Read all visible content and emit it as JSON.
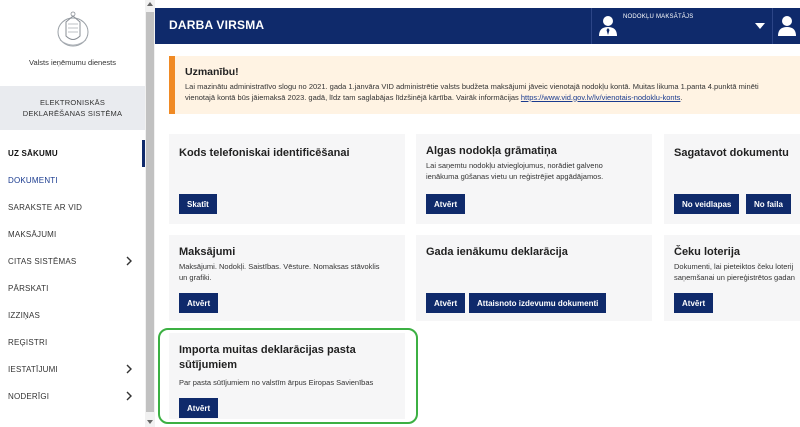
{
  "sidebar": {
    "org_name": "Valsts ieņēmumu dienests",
    "system_line1": "ELEKTRONISKĀS",
    "system_line2": "DEKLARĒŠANAS SISTĒMA",
    "items": [
      {
        "label": "UZ SĀKUMU",
        "active": true
      },
      {
        "label": "DOKUMENTI"
      },
      {
        "label": "SARAKSTE AR VID"
      },
      {
        "label": "MAKSĀJUMI"
      },
      {
        "label": "CITAS SISTĒMAS",
        "expandable": true
      },
      {
        "label": "PĀRSKATI"
      },
      {
        "label": "IZZIŅAS"
      },
      {
        "label": "REĢISTRI"
      },
      {
        "label": "IESTATĪJUMI",
        "expandable": true
      },
      {
        "label": "NODERĪGI",
        "expandable": true
      }
    ]
  },
  "header": {
    "title": "DARBA VIRSMA",
    "user_role": "NODOKĻU MAKSĀTĀJS"
  },
  "warning": {
    "title": "Uzmanību!",
    "line1": "Lai mazinātu administratīvo slogu no 2021. gada 1.janvāra VID administrētie valsts budžeta maksājumi jāveic vienotajā nodokļu kontā. Muitas likuma 1.panta 4.punktā minēti",
    "line2": "vienotajā kontā būs jāiemaksā 2023. gadā, līdz tam saglabājas līdzšinējā kārtība. Vairāk informācijas ",
    "link": "https://www.vid.gov.lv/lv/vienotais-nodoklu-konts",
    "line2_end": "."
  },
  "cards": {
    "kods": {
      "title": "Kods telefoniskai identificēšanai",
      "button": "Skatīt"
    },
    "algas": {
      "title": "Algas nodokļa grāmatiņa",
      "desc1": "Lai saņemtu nodokļu atvieglojumus, norādiet galveno",
      "desc2": "ienākuma gūšanas vietu un reģistrējiet apgādājamos.",
      "button": "Atvērt"
    },
    "sagatavot": {
      "title": "Sagatavot dokumentu",
      "button1": "No veidlapas",
      "button2": "No faila"
    },
    "maksajumi": {
      "title": "Maksājumi",
      "desc1": "Maksājumi. Nodokļi. Saistības. Vēsture. Nomaksas stāvoklis",
      "desc2": "un grafiki.",
      "button": "Atvērt"
    },
    "gada": {
      "title": "Gada ienākumu deklarācija",
      "button1": "Atvērt",
      "button2": "Attaisnoto izdevumu dokumenti"
    },
    "ceku": {
      "title": "Čeku loterija",
      "desc1": "Dokumenti, lai pieteiktos čeku loterij",
      "desc2": "saņemšanai un piereģistrētos gadan",
      "button": "Atvērt"
    },
    "importa": {
      "title1": "Importa muitas deklarācijas pasta",
      "title2": "sūtījumiem",
      "desc": "Par pasta sūtījumiem no valstīm ārpus Eiropas Savienības",
      "button": "Atvērt"
    }
  },
  "colors": {
    "brand": "#0f2a6b",
    "warning_accent": "#f08a24",
    "warning_bg": "#fff3e3",
    "card_bg": "#f6f6f7",
    "highlight": "#3cb043"
  }
}
